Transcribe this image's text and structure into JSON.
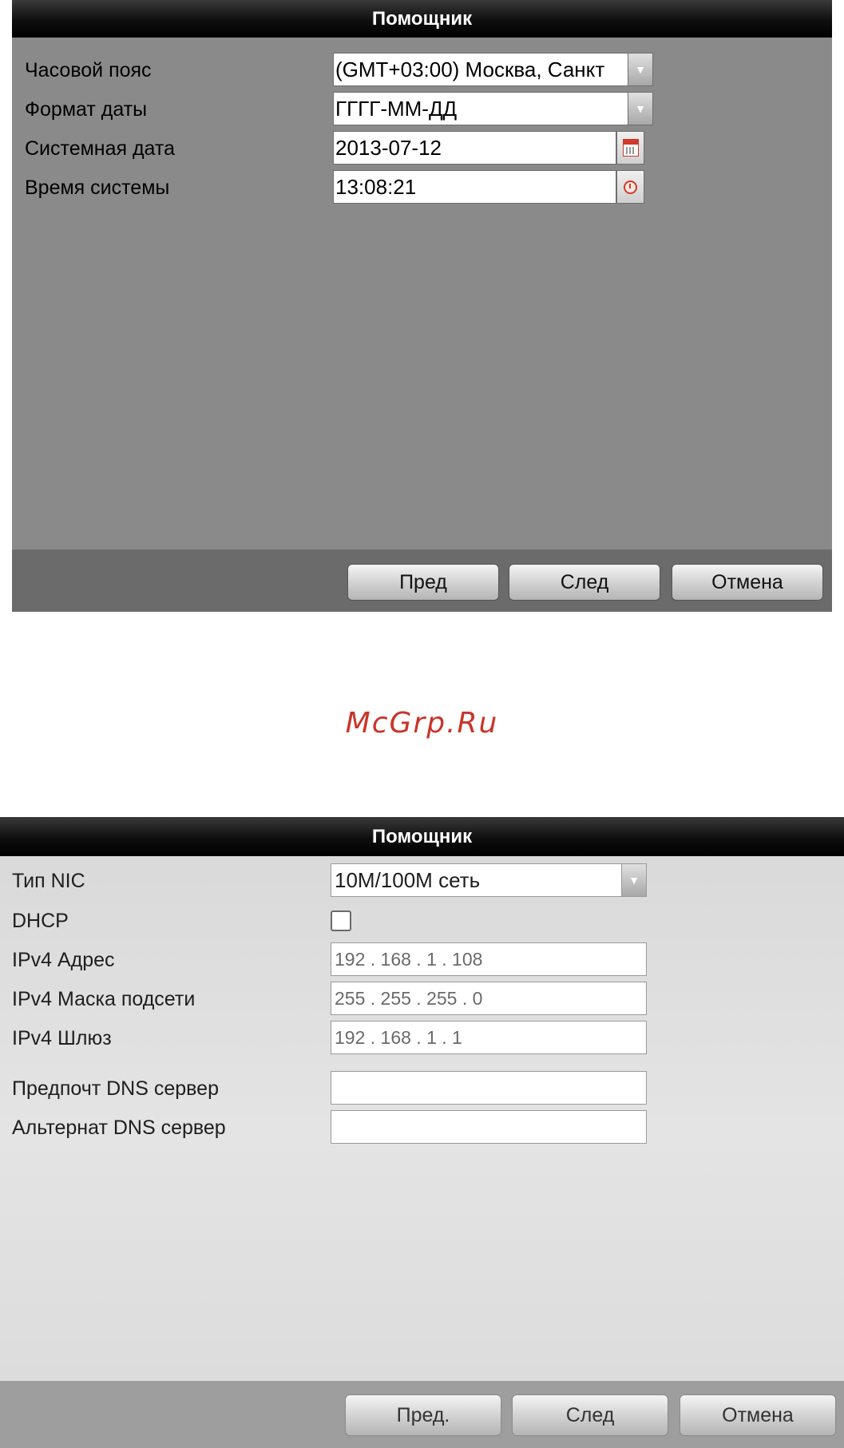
{
  "wizard1": {
    "title": "Помощник",
    "timezone": {
      "label": "Часовой пояс",
      "value": "(GMT+03:00) Москва, Санкт"
    },
    "date_format": {
      "label": "Формат даты",
      "value": "ГГГГ-ММ-ДД"
    },
    "system_date": {
      "label": "Системная дата",
      "value": "2013-07-12"
    },
    "system_time": {
      "label": "Время системы",
      "value": "13:08:21"
    },
    "buttons": {
      "prev": "Пред",
      "next": "След",
      "cancel": "Отмена"
    }
  },
  "watermark": "McGrp.Ru",
  "wizard2": {
    "title": "Помощник",
    "nic_type": {
      "label": "Тип NIC",
      "value": "10M/100M сеть"
    },
    "dhcp": {
      "label": "DHCP",
      "checked": false
    },
    "ipv4_address": {
      "label": "IPv4 Адрес",
      "value": "192 . 168 . 1    . 108"
    },
    "ipv4_mask": {
      "label": "IPv4 Маска подсети",
      "value": "255 . 255 . 255 . 0"
    },
    "ipv4_gateway": {
      "label": "IPv4 Шлюз",
      "value": "192 . 168 . 1    . 1"
    },
    "preferred_dns": {
      "label": "Предпочт DNS сервер",
      "value": ""
    },
    "alternate_dns": {
      "label": "Альтернат DNS сервер",
      "value": ""
    },
    "buttons": {
      "prev": "Пред.",
      "next": "След",
      "cancel": "Отмена"
    }
  },
  "colors": {
    "watermark": "#c8352a",
    "titlebar": "#000000"
  },
  "icons": {
    "dropdown": "chevron-down-icon",
    "calendar": "calendar-icon",
    "clock": "clock-icon"
  }
}
